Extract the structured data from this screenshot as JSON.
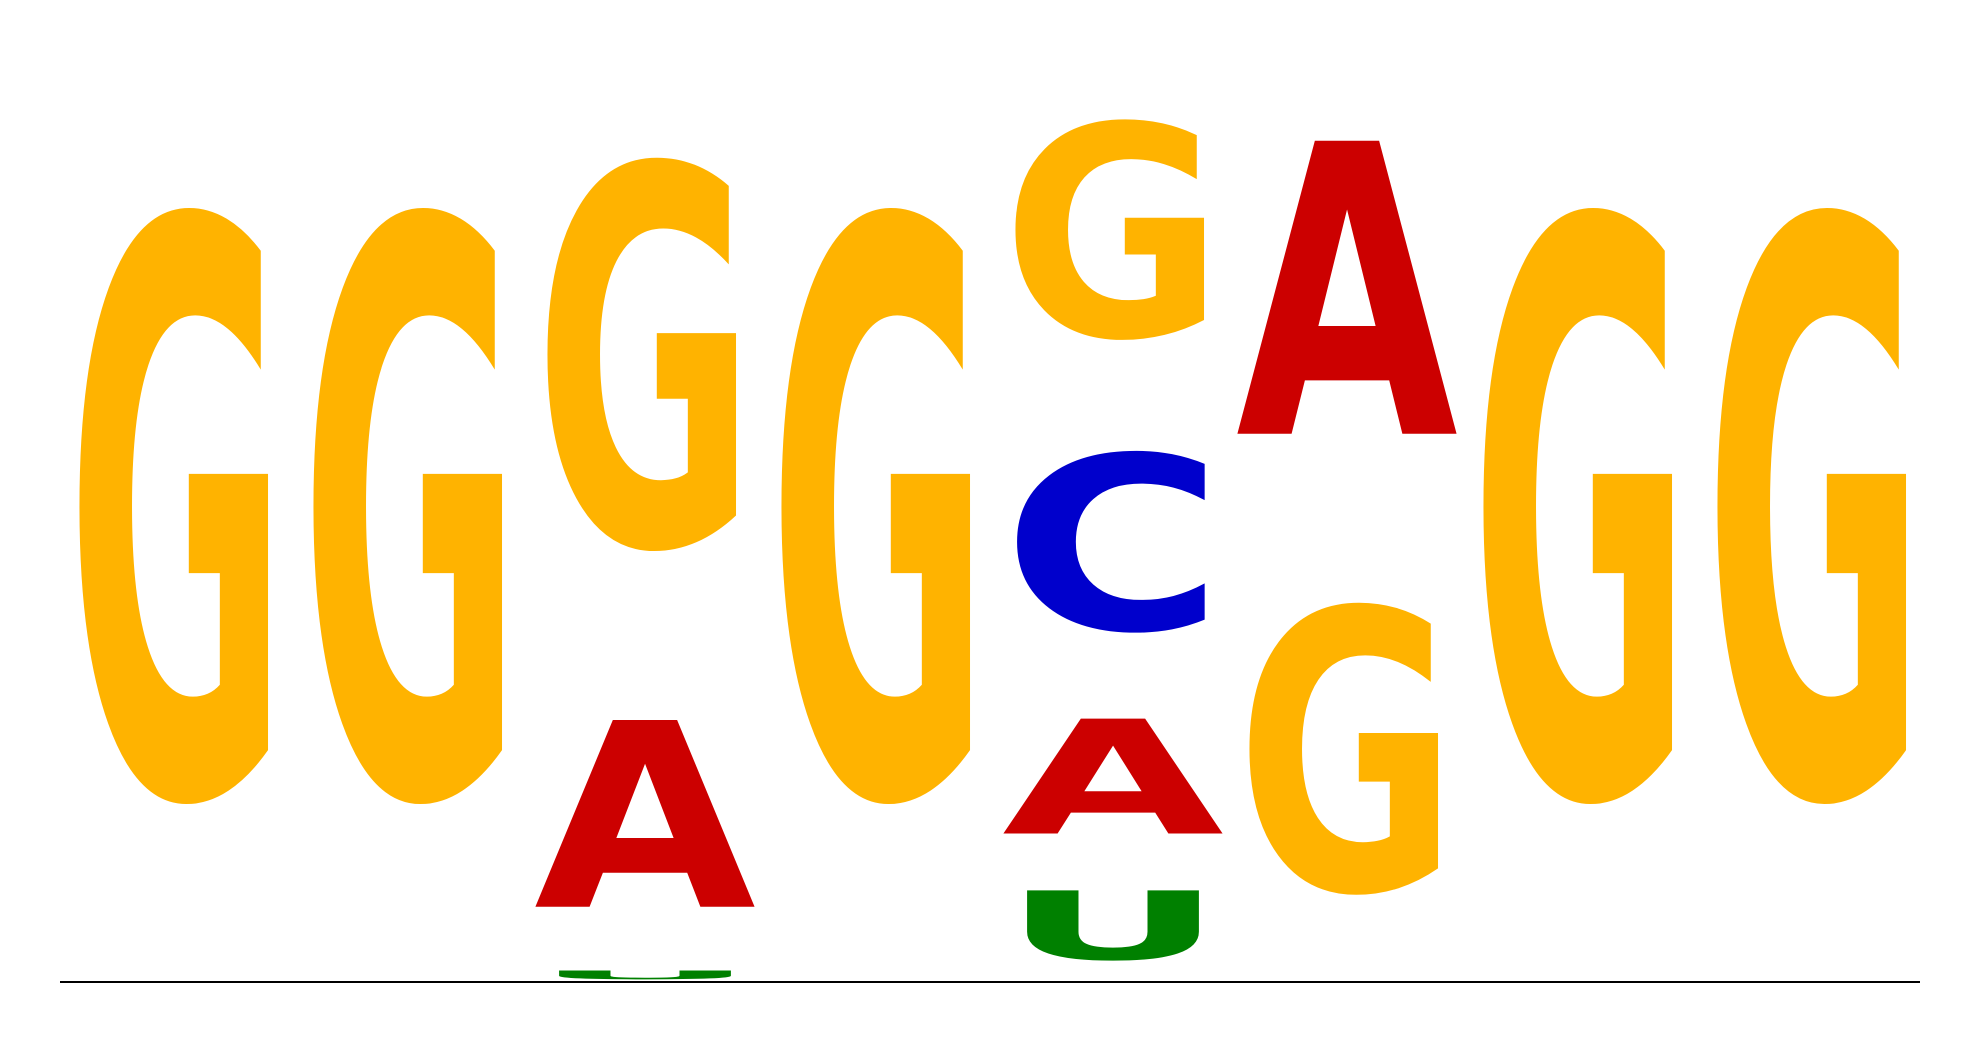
{
  "chart_data": {
    "type": "sequence-logo",
    "alphabet": [
      "A",
      "C",
      "G",
      "U"
    ],
    "colors": {
      "A": "#CC0000",
      "C": "#0000CC",
      "G": "#FFB300",
      "U": "#008000"
    },
    "ylim": [
      0,
      2
    ],
    "positions": [
      {
        "index": 1,
        "letters": [
          {
            "base": "G",
            "height": 2.0
          }
        ]
      },
      {
        "index": 2,
        "letters": [
          {
            "base": "G",
            "height": 2.0
          }
        ]
      },
      {
        "index": 3,
        "letters": [
          {
            "base": "U",
            "height": 0.03
          },
          {
            "base": "A",
            "height": 0.65
          },
          {
            "base": "G",
            "height": 1.32
          }
        ]
      },
      {
        "index": 4,
        "letters": [
          {
            "base": "G",
            "height": 2.0
          }
        ]
      },
      {
        "index": 5,
        "letters": [
          {
            "base": "U",
            "height": 0.24
          },
          {
            "base": "A",
            "height": 0.4
          },
          {
            "base": "C",
            "height": 0.61
          },
          {
            "base": "G",
            "height": 0.74
          }
        ]
      },
      {
        "index": 6,
        "letters": [
          {
            "base": "G",
            "height": 0.98
          },
          {
            "base": "A",
            "height": 1.02
          }
        ]
      },
      {
        "index": 7,
        "letters": [
          {
            "base": "G",
            "height": 2.0
          }
        ]
      },
      {
        "index": 8,
        "letters": [
          {
            "base": "G",
            "height": 2.0
          }
        ]
      }
    ]
  }
}
